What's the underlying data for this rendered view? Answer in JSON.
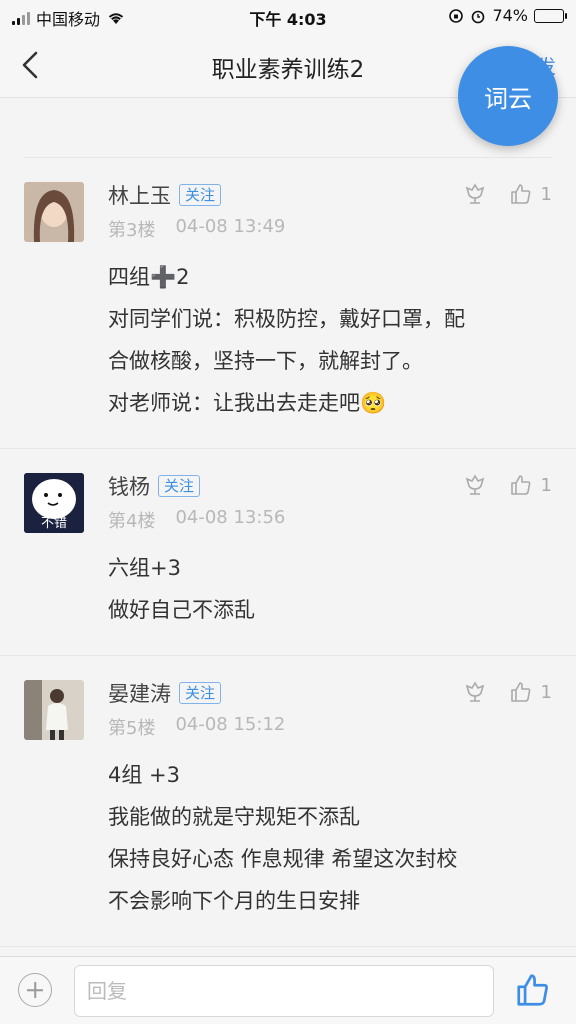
{
  "status_bar": {
    "carrier": "中国移动",
    "time": "下午 4:03",
    "battery": "74%",
    "battery_level": 0.74
  },
  "nav": {
    "title": "职业素养训练2",
    "action_label": "再次发"
  },
  "fab": {
    "label": "词云"
  },
  "posts": [
    {
      "name": "林上玉",
      "follow_label": "关注",
      "floor": "第3楼",
      "time": "04-08 13:49",
      "likes": "1",
      "lines": [
        "四组➕2",
        "对同学们说：积极防控，戴好口罩，配",
        "合做核酸，坚持一下，就解封了。",
        "对老师说：让我出去走走吧🥺"
      ]
    },
    {
      "name": "钱杨",
      "follow_label": "关注",
      "floor": "第4楼",
      "time": "04-08 13:56",
      "likes": "1",
      "avatar_text": "不错",
      "lines": [
        "六组+3",
        "做好自己不添乱"
      ]
    },
    {
      "name": "晏建涛",
      "follow_label": "关注",
      "floor": "第5楼",
      "time": "04-08 15:12",
      "likes": "1",
      "lines": [
        "4组 +3",
        "我能做的就是守规矩不添乱",
        "保持良好心态 作息规律 希望这次封校",
        "不会影响下个月的生日安排"
      ]
    }
  ],
  "reply": {
    "placeholder": "回复"
  },
  "colors": {
    "accent": "#3e8ee6",
    "background": "#f4f4f4"
  }
}
